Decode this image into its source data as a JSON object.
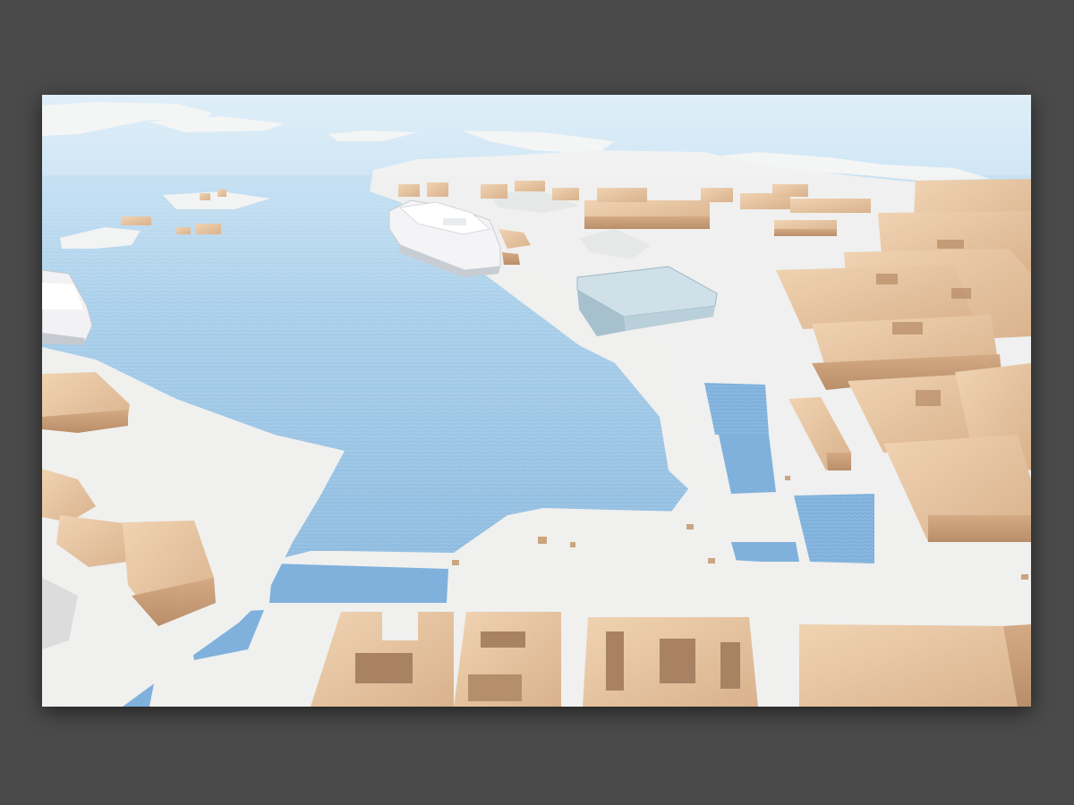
{
  "viewer": {
    "background_color": "#4a4a4a",
    "image_subject": "harbour-model-render"
  },
  "palette": {
    "water": "#8fbbe0",
    "water_deep": "#6fa3d2",
    "land": "#efefee",
    "building_top": "#e9c9a6",
    "building_side": "#c99f7b",
    "building_shadow": "#b88d69",
    "terminal_glass": "#b9cfd9"
  }
}
